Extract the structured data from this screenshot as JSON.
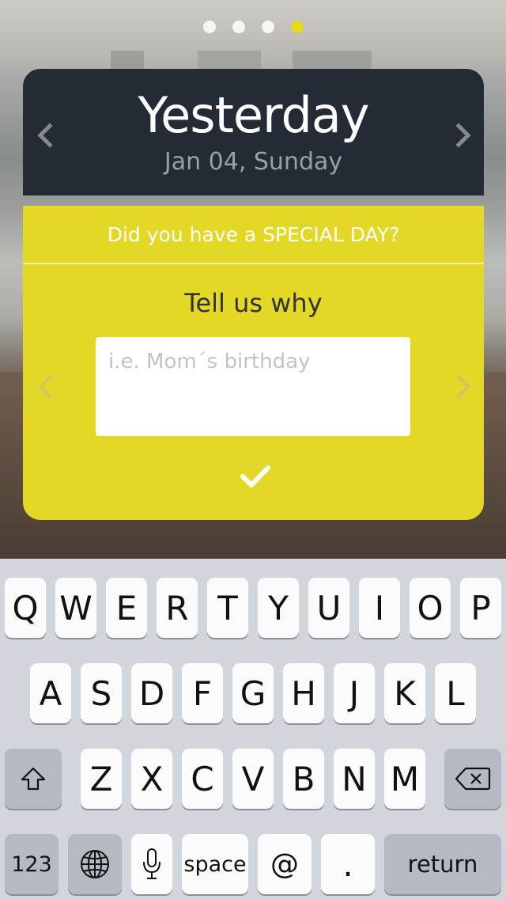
{
  "pager": {
    "count": 4,
    "active_index": 3
  },
  "header": {
    "title": "Yesterday",
    "date": "Jan 04, Sunday"
  },
  "prompt": {
    "question": "Did you have a SPECIAL DAY?",
    "tell_label": "Tell us why",
    "input_value": "",
    "input_placeholder": "i.e. Mom´s birthday"
  },
  "icons": {
    "prev": "chevron-left-icon",
    "next": "chevron-right-icon",
    "confirm": "checkmark-icon",
    "shift": "shift-icon",
    "backspace": "backspace-icon",
    "globe": "globe-icon",
    "mic": "microphone-icon"
  },
  "colors": {
    "header_bg": "#252b35",
    "accent_yellow": "#e4d826",
    "keyboard_bg": "#d2d5db"
  },
  "keyboard": {
    "row1": [
      "Q",
      "W",
      "E",
      "R",
      "T",
      "Y",
      "U",
      "I",
      "O",
      "P"
    ],
    "row2": [
      "A",
      "S",
      "D",
      "F",
      "G",
      "H",
      "J",
      "K",
      "L"
    ],
    "row3": [
      "Z",
      "X",
      "C",
      "V",
      "B",
      "N",
      "M"
    ],
    "numbers_label": "123",
    "space_label": "space",
    "at_label": "@",
    "dot_label": ".",
    "return_label": "return"
  }
}
